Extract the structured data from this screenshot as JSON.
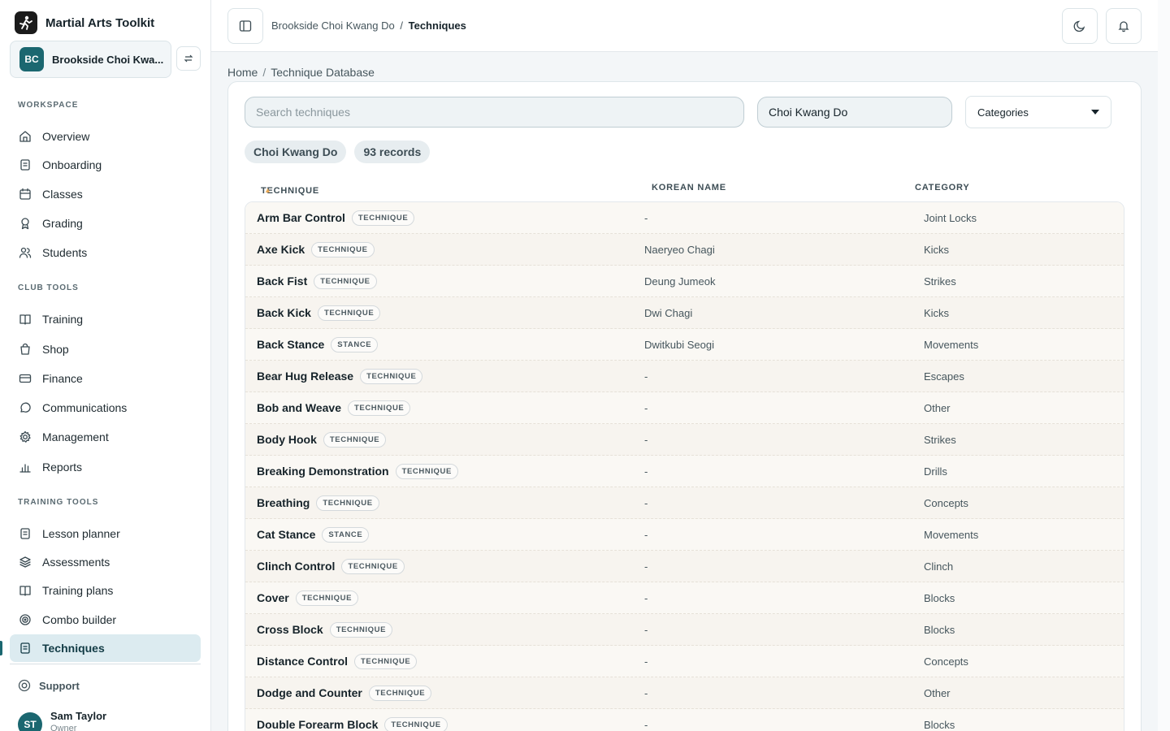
{
  "app": {
    "title": "Martial Arts Toolkit"
  },
  "club": {
    "initials": "BC",
    "name": "Brookside Choi Kwa..."
  },
  "sidebar": {
    "sections": [
      {
        "label": "WORKSPACE",
        "items": [
          {
            "label": "Overview",
            "icon": "home-icon"
          },
          {
            "label": "Onboarding",
            "icon": "clipboard-icon"
          },
          {
            "label": "Classes",
            "icon": "calendar-icon"
          },
          {
            "label": "Grading",
            "icon": "award-icon"
          },
          {
            "label": "Students",
            "icon": "users-icon"
          }
        ]
      },
      {
        "label": "CLUB TOOLS",
        "items": [
          {
            "label": "Training",
            "icon": "book-icon"
          },
          {
            "label": "Shop",
            "icon": "shopping-bag-icon"
          },
          {
            "label": "Finance",
            "icon": "credit-card-icon"
          },
          {
            "label": "Communications",
            "icon": "message-circle-icon"
          },
          {
            "label": "Management",
            "icon": "gear-icon"
          },
          {
            "label": "Reports",
            "icon": "bar-chart-icon"
          }
        ]
      },
      {
        "label": "TRAINING TOOLS",
        "items": [
          {
            "label": "Lesson planner",
            "icon": "clipboard-icon"
          },
          {
            "label": "Assessments",
            "icon": "layers-icon"
          },
          {
            "label": "Training plans",
            "icon": "book-icon"
          },
          {
            "label": "Combo builder",
            "icon": "target-icon"
          },
          {
            "label": "Techniques",
            "icon": "clipboard-icon",
            "active": true
          }
        ]
      }
    ],
    "support": "Support",
    "user": {
      "initials": "ST",
      "name": "Sam Taylor",
      "role": "Owner"
    }
  },
  "topbar": {
    "crumb_parent": "Brookside Choi Kwang Do",
    "crumb_sep": "/",
    "crumb_current": "Techniques"
  },
  "breadcrumb": {
    "home": "Home",
    "sep": "/",
    "current": "Technique Database"
  },
  "filters": {
    "search_placeholder": "Search techniques",
    "style_value": "Choi Kwang Do",
    "categories_label": "Categories"
  },
  "chips": {
    "style": "Choi Kwang Do",
    "count": "93 records"
  },
  "table": {
    "headers": {
      "technique": "TECHNIQUE",
      "korean": "KOREAN NAME",
      "category": "CATEGORY"
    },
    "rows": [
      {
        "name": "Arm Bar Control",
        "type": "TECHNIQUE",
        "korean": "-",
        "category": "Joint Locks"
      },
      {
        "name": "Axe Kick",
        "type": "TECHNIQUE",
        "korean": "Naeryeo Chagi",
        "category": "Kicks"
      },
      {
        "name": "Back Fist",
        "type": "TECHNIQUE",
        "korean": "Deung Jumeok",
        "category": "Strikes"
      },
      {
        "name": "Back Kick",
        "type": "TECHNIQUE",
        "korean": "Dwi Chagi",
        "category": "Kicks"
      },
      {
        "name": "Back Stance",
        "type": "STANCE",
        "korean": "Dwitkubi Seogi",
        "category": "Movements"
      },
      {
        "name": "Bear Hug Release",
        "type": "TECHNIQUE",
        "korean": "-",
        "category": "Escapes"
      },
      {
        "name": "Bob and Weave",
        "type": "TECHNIQUE",
        "korean": "-",
        "category": "Other"
      },
      {
        "name": "Body Hook",
        "type": "TECHNIQUE",
        "korean": "-",
        "category": "Strikes"
      },
      {
        "name": "Breaking Demonstration",
        "type": "TECHNIQUE",
        "korean": "-",
        "category": "Drills"
      },
      {
        "name": "Breathing",
        "type": "TECHNIQUE",
        "korean": "-",
        "category": "Concepts"
      },
      {
        "name": "Cat Stance",
        "type": "STANCE",
        "korean": "-",
        "category": "Movements"
      },
      {
        "name": "Clinch Control",
        "type": "TECHNIQUE",
        "korean": "-",
        "category": "Clinch"
      },
      {
        "name": "Cover",
        "type": "TECHNIQUE",
        "korean": "-",
        "category": "Blocks"
      },
      {
        "name": "Cross Block",
        "type": "TECHNIQUE",
        "korean": "-",
        "category": "Blocks"
      },
      {
        "name": "Distance Control",
        "type": "TECHNIQUE",
        "korean": "-",
        "category": "Concepts"
      },
      {
        "name": "Dodge and Counter",
        "type": "TECHNIQUE",
        "korean": "-",
        "category": "Other"
      },
      {
        "name": "Double Forearm Block",
        "type": "TECHNIQUE",
        "korean": "-",
        "category": "Blocks"
      }
    ]
  },
  "colors": {
    "accent": "#1b6770",
    "active_bg": "#dcebf0",
    "row_bg": "#faf8f4"
  }
}
